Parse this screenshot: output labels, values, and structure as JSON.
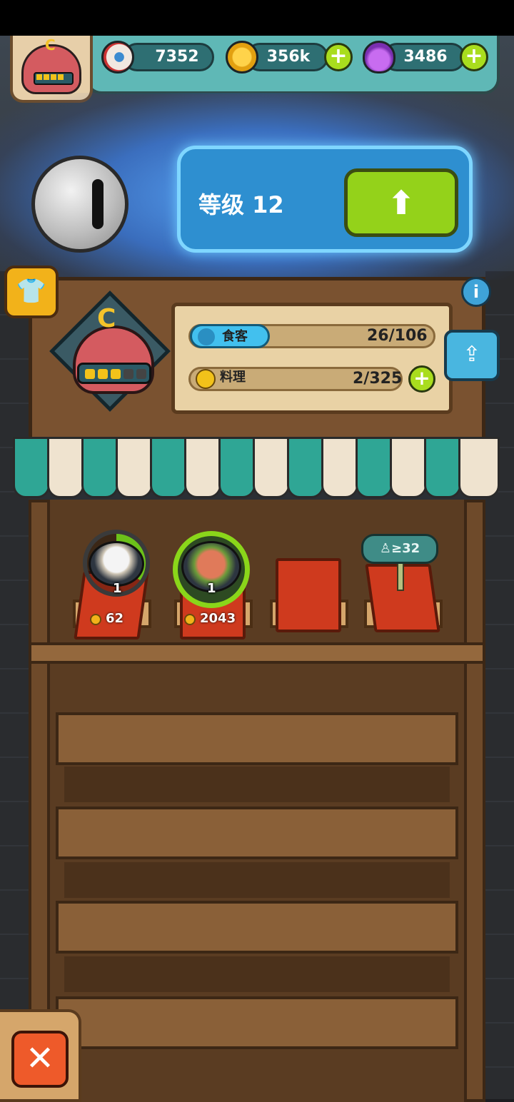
{
  "resources": {
    "eyeballs": "7352",
    "coins": "356k",
    "potions": "3486"
  },
  "level": {
    "label": "等级 12"
  },
  "shop": {
    "grade": "C",
    "diners_label": "食客",
    "diners_value": "26/106",
    "dishes_label": "料理",
    "dishes_value": "2/325"
  },
  "dishes": [
    {
      "qty": "1",
      "price": "62",
      "progress": 0.35
    },
    {
      "qty": "1",
      "price": "2043",
      "progress": 1.0
    }
  ],
  "locked_slot": {
    "requirement": "≥32"
  },
  "icons": {
    "eyeball": "eyeball-icon",
    "coin": "coin-icon",
    "potion": "potion-icon",
    "plus": "plus-icon",
    "upgrade": "up-arrow-icon",
    "shirt": "shirt-icon",
    "info": "info-icon",
    "share": "share-icon",
    "close": "close-icon",
    "diner": "person-icon",
    "dish": "cloche-icon"
  },
  "colors": {
    "accent_green": "#94d21a",
    "panel_blue": "#2e8fd0",
    "teal": "#5fb8b6",
    "wood": "#7a5230",
    "close_orange": "#ee5a2a"
  }
}
